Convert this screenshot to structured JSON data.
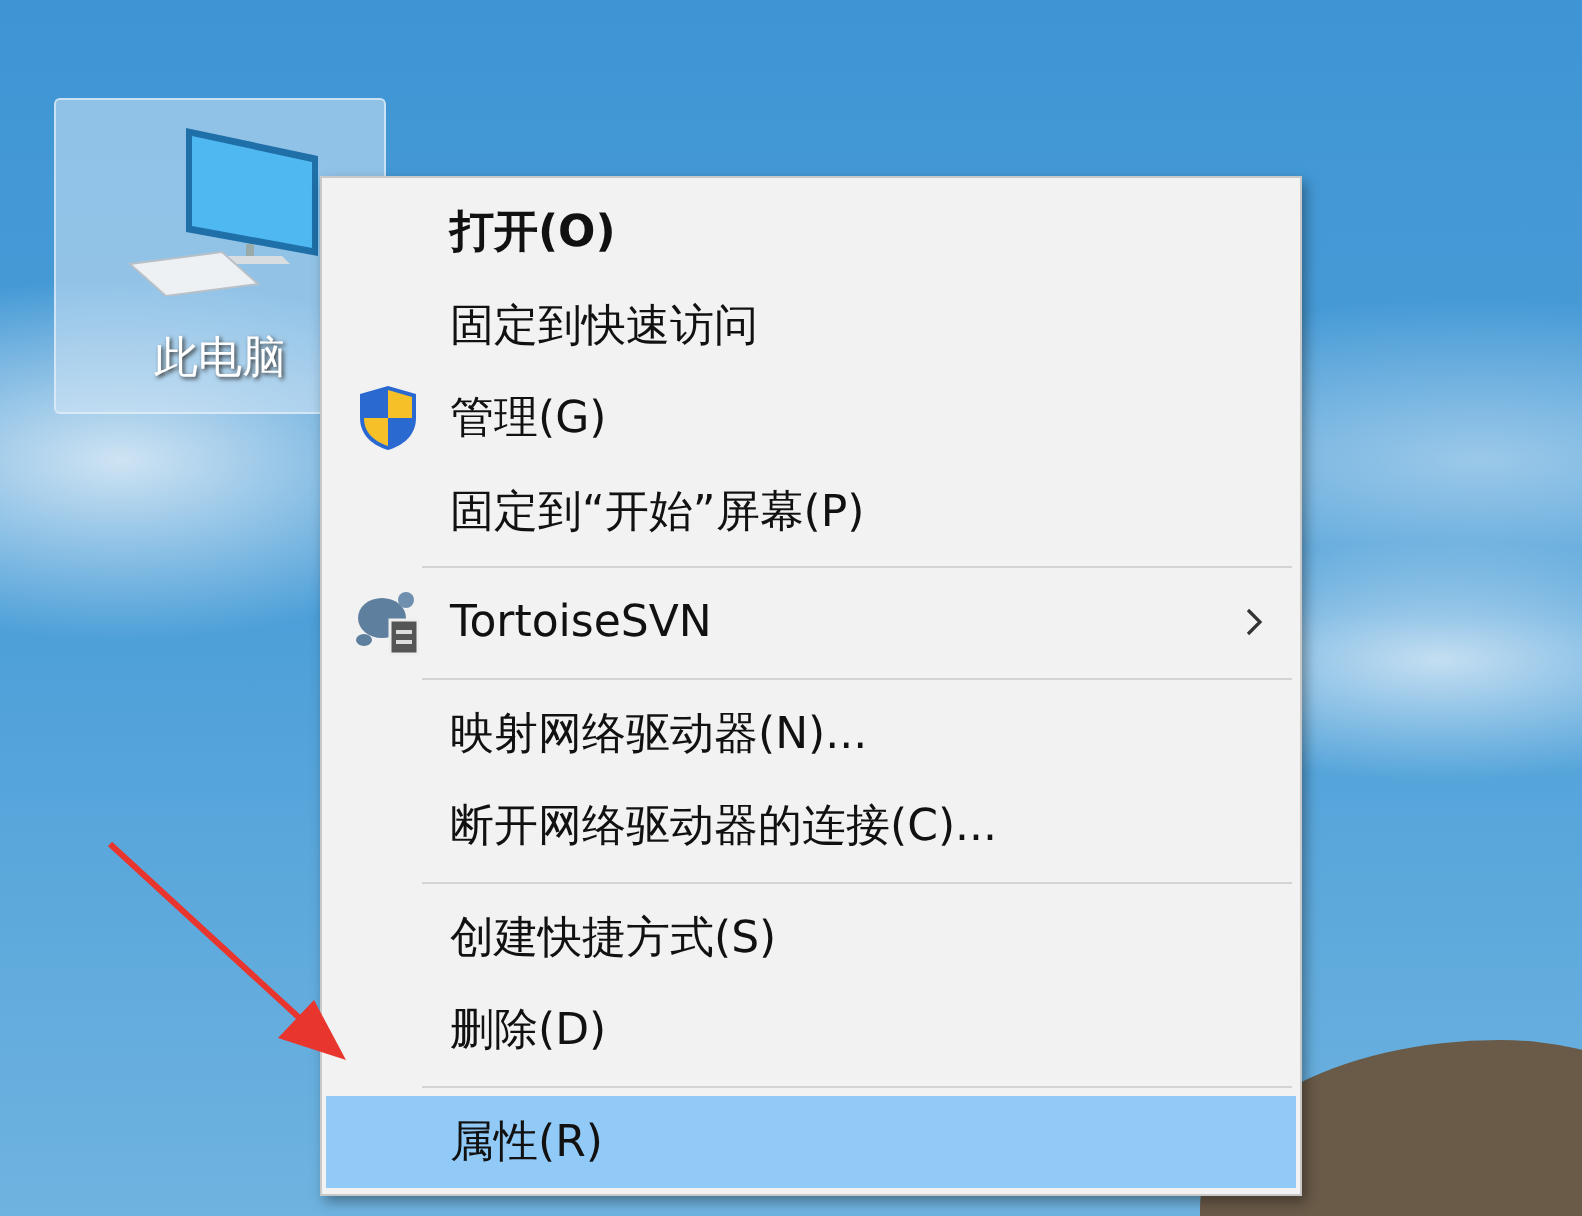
{
  "desktop_icon": {
    "label": "此电脑",
    "selected": true
  },
  "context_menu": {
    "items": [
      {
        "kind": "item",
        "label": "打开(O)",
        "default": true,
        "selected": false,
        "submenu": false
      },
      {
        "kind": "item",
        "label": "固定到快速访问",
        "default": false,
        "selected": false,
        "submenu": false
      },
      {
        "kind": "admin",
        "label": "管理(G)",
        "default": false,
        "selected": false,
        "submenu": false
      },
      {
        "kind": "item",
        "label": "固定到“开始”屏幕(P)",
        "default": false,
        "selected": false,
        "submenu": false
      },
      {
        "kind": "separator"
      },
      {
        "kind": "addon",
        "label": "TortoiseSVN",
        "default": false,
        "selected": false,
        "submenu": true
      },
      {
        "kind": "separator"
      },
      {
        "kind": "item",
        "label": "映射网络驱动器(N)...",
        "default": false,
        "selected": false,
        "submenu": false
      },
      {
        "kind": "item",
        "label": "断开网络驱动器的连接(C)...",
        "default": false,
        "selected": false,
        "submenu": false
      },
      {
        "kind": "separator"
      },
      {
        "kind": "item",
        "label": "创建快捷方式(S)",
        "default": false,
        "selected": false,
        "submenu": false
      },
      {
        "kind": "item",
        "label": "删除(D)",
        "default": false,
        "selected": false,
        "submenu": false
      },
      {
        "kind": "separator"
      },
      {
        "kind": "item",
        "label": "属性(R)",
        "default": false,
        "selected": true,
        "submenu": false
      }
    ]
  }
}
